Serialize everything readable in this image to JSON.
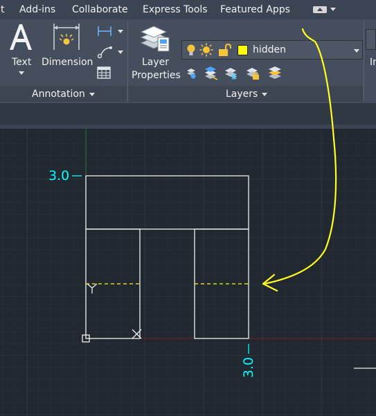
{
  "menubar": {
    "items": [
      "t",
      "Add-ins",
      "Collaborate",
      "Express Tools",
      "Featured Apps"
    ]
  },
  "ribbon": {
    "annotation": {
      "title": "Annotation",
      "text_label": "Text",
      "dimension_label": "Dimension"
    },
    "layers": {
      "title": "Layers",
      "layer_properties_line1": "Layer",
      "layer_properties_line2": "Properties",
      "current_layer": {
        "name": "hidden",
        "color": "#ffff00"
      }
    },
    "cut_label": "In"
  },
  "drawing": {
    "y_dimension": "3.0",
    "x_dimension": "3.0",
    "colors": {
      "background": "#212830",
      "grid": "#2c343f",
      "geometry": "#ffffff",
      "hidden_line": "#ffff00",
      "dimension": "#00ffff",
      "annotation": "#ffff00"
    }
  }
}
